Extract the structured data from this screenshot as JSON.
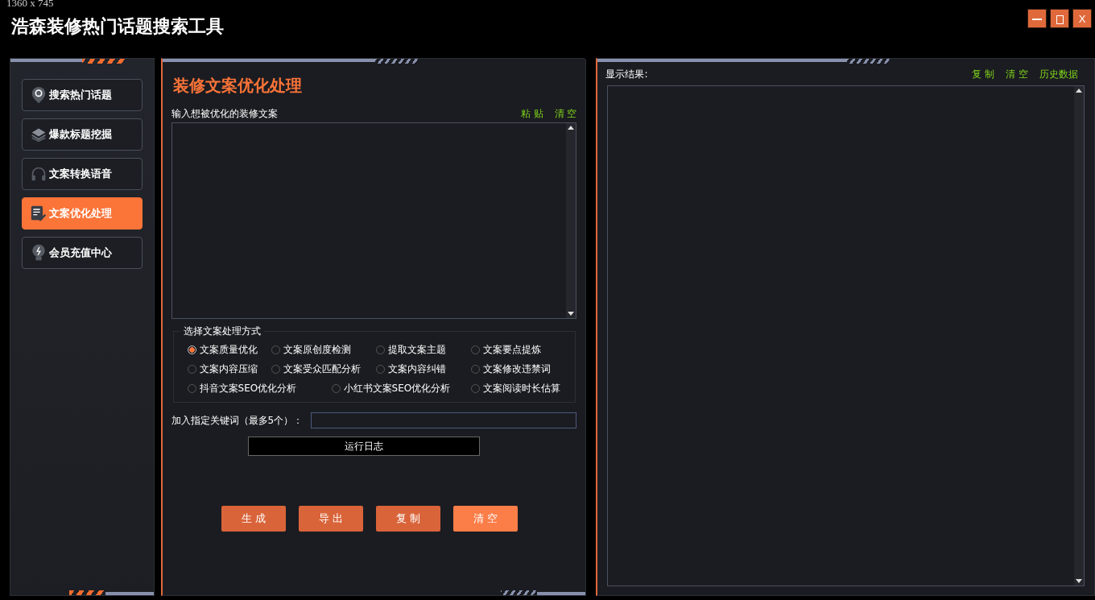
{
  "size_caption": "1360 x 745",
  "window": {
    "title": "浩森装修热门话题搜索工具",
    "controls": [
      {
        "kind": "minimize"
      },
      {
        "kind": "maximize"
      },
      {
        "kind": "close",
        "label": "X"
      }
    ]
  },
  "sidebar": {
    "items": [
      {
        "label": "搜索热门话题",
        "selected": false
      },
      {
        "label": "爆款标题挖掘",
        "selected": false
      },
      {
        "label": "文案转换语音",
        "selected": false
      },
      {
        "label": "文案优化处理",
        "selected": true
      },
      {
        "label": "会员充值中心",
        "selected": false
      }
    ]
  },
  "editor": {
    "title": "装修文案优化处理",
    "input_label": "输入想被优化的装修文案",
    "input_actions": [
      "粘 贴",
      "清 空"
    ],
    "mode_group": {
      "title": "选择文案处理方式",
      "options": [
        {
          "label": "文案质量优化",
          "selected": true
        },
        {
          "label": "文案原创度检测",
          "selected": false
        },
        {
          "label": "提取文案主题",
          "selected": false
        },
        {
          "label": "文案要点提炼",
          "selected": false
        },
        {
          "label": "文案内容压缩",
          "selected": false
        },
        {
          "label": "文案受众匹配分析",
          "selected": false
        },
        {
          "label": "文案内容纠错",
          "selected": false
        },
        {
          "label": "文案修改违禁词",
          "selected": false
        },
        {
          "label": "抖音文案SEO优化分析",
          "selected": false
        },
        {
          "label": "小红书文案SEO优化分析",
          "selected": false
        },
        {
          "label": "文案阅读时长估算",
          "selected": false
        }
      ]
    },
    "keyword_label": "加入指定关键词（最多5个）：",
    "log_label": "运行日志",
    "buttons": [
      {
        "label": "生 成",
        "hovered": false
      },
      {
        "label": "导 出",
        "hovered": false
      },
      {
        "label": "复 制",
        "hovered": false
      },
      {
        "label": "清 空",
        "hovered": true
      }
    ]
  },
  "result": {
    "label": "显示结果:",
    "actions": [
      "复 制",
      "清 空",
      "历史数据"
    ]
  }
}
